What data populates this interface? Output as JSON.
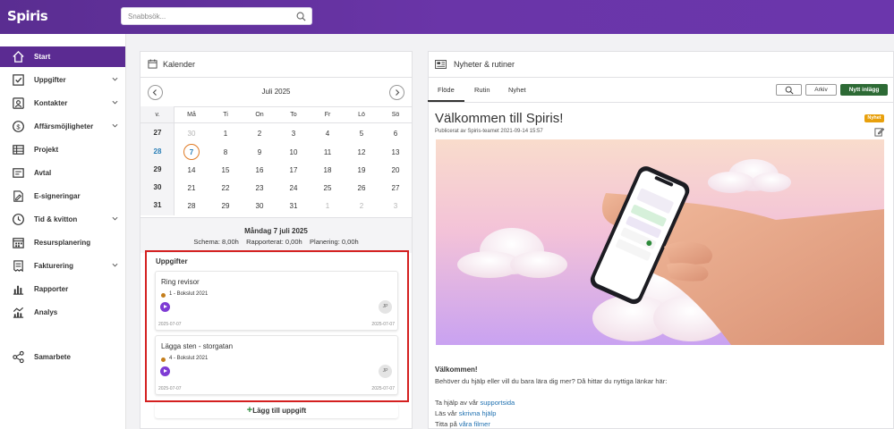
{
  "app": {
    "logo": "Spiris"
  },
  "search": {
    "placeholder": "Snabbsök..."
  },
  "sidebar": {
    "items": [
      {
        "label": "Start",
        "icon": "home-icon",
        "active": true
      },
      {
        "label": "Uppgifter",
        "icon": "checkbox-icon",
        "expandable": true
      },
      {
        "label": "Kontakter",
        "icon": "contact-card-icon",
        "expandable": true
      },
      {
        "label": "Affärsmöjligheter",
        "icon": "dollar-icon",
        "expandable": true
      },
      {
        "label": "Projekt",
        "icon": "table-icon"
      },
      {
        "label": "Avtal",
        "icon": "agreement-icon"
      },
      {
        "label": "E-signeringar",
        "icon": "signature-icon"
      },
      {
        "label": "Tid & kvitton",
        "icon": "clock-icon",
        "expandable": true
      },
      {
        "label": "Resursplanering",
        "icon": "calendar-grid-icon"
      },
      {
        "label": "Fakturering",
        "icon": "invoice-icon",
        "expandable": true
      },
      {
        "label": "Rapporter",
        "icon": "bar-chart-icon"
      },
      {
        "label": "Analys",
        "icon": "analytics-icon"
      },
      {
        "label": "Samarbete",
        "icon": "share-icon"
      }
    ]
  },
  "calendar": {
    "title": "Kalender",
    "month": "Juli 2025",
    "week_header": "v.",
    "day_headers": [
      "Må",
      "Ti",
      "On",
      "To",
      "Fr",
      "Lö",
      "Sö"
    ],
    "weeks": [
      {
        "week": "27",
        "days": [
          "30",
          "1",
          "2",
          "3",
          "4",
          "5",
          "6"
        ]
      },
      {
        "week": "28",
        "days": [
          "7",
          "8",
          "9",
          "10",
          "11",
          "12",
          "13"
        ]
      },
      {
        "week": "29",
        "days": [
          "14",
          "15",
          "16",
          "17",
          "18",
          "19",
          "20"
        ]
      },
      {
        "week": "30",
        "days": [
          "21",
          "22",
          "23",
          "24",
          "25",
          "26",
          "27"
        ]
      },
      {
        "week": "31",
        "days": [
          "28",
          "29",
          "30",
          "31",
          "1",
          "2",
          "3"
        ]
      }
    ],
    "selected_day": "Måndag 7 juli 2025",
    "schema": "Schema: 8,00h",
    "rapporterat": "Rapporterat: 0,00h",
    "planering": "Planering: 0,00h"
  },
  "tasks": {
    "title": "Uppgifter",
    "items": [
      {
        "name": "Ring revisor",
        "sub": "1 - Bokslut 2021",
        "avatar": "JP",
        "date_start": "2025-07-07",
        "date_end": "2025-07-07"
      },
      {
        "name": "Lägga sten - storgatan",
        "sub": "4 - Bokslut 2021",
        "avatar": "JP",
        "date_start": "2025-07-07",
        "date_end": "2025-07-07"
      }
    ],
    "add_label": "Lägg till uppgift"
  },
  "news": {
    "title": "Nyheter & rutiner",
    "tabs": [
      "Flöde",
      "Rutin",
      "Nyhet"
    ],
    "archive_label": "Arkiv",
    "new_post_label": "Nytt inlägg",
    "post": {
      "title": "Välkommen till Spiris!",
      "meta": "Publicerat av Spiris-teamet 2021-09-14 15:57",
      "badge": "Nyhet",
      "body_heading": "Välkommen!",
      "body_text": "Behöver du hjälp eller vill du bara lära dig mer? Då hittar du nyttiga länkar här:",
      "link1_prefix": "Ta hjälp av vår ",
      "link1": "supportsida",
      "link2_prefix": "Läs vår ",
      "link2": "skrivna hjälp",
      "link3_prefix": "Titta på ",
      "link3": "våra filmer"
    }
  },
  "colors": {
    "brand": "#5b2b92",
    "accent_green": "#2d6a35",
    "badge": "#e8a00c",
    "highlight": "#d42020",
    "link": "#1f70b0"
  }
}
